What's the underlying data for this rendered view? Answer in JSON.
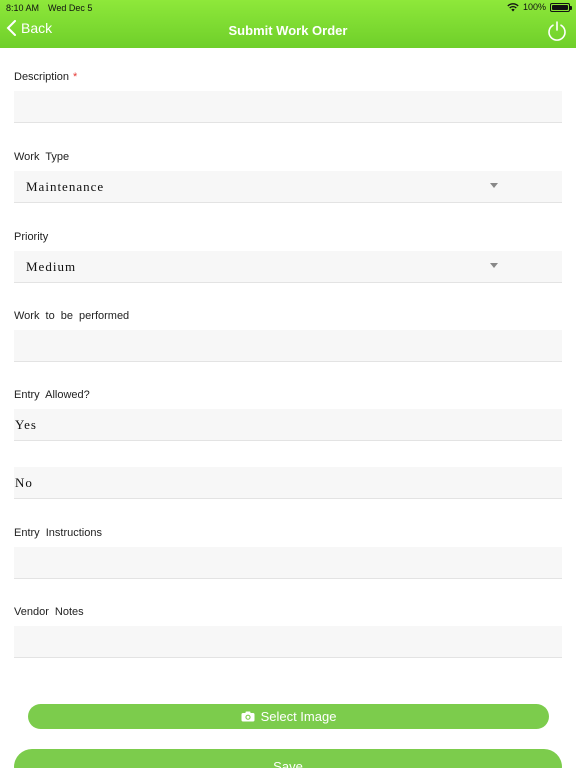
{
  "status_bar": {
    "time": "8:10 AM",
    "date": "Wed Dec 5",
    "battery": "100%",
    "battery_level": 1.0
  },
  "header": {
    "back_label": "Back",
    "title": "Submit Work Order",
    "power_icon": "power-icon"
  },
  "form": {
    "description": {
      "label": "Description",
      "required_mark": "*",
      "value": ""
    },
    "work_type": {
      "label": "Work Type",
      "value": "Maintenance"
    },
    "priority": {
      "label": "Priority",
      "value": "Medium"
    },
    "work_to_be_performed": {
      "label": "Work to be performed",
      "value": ""
    },
    "entry_allowed": {
      "label": "Entry Allowed?",
      "options": [
        "Yes",
        "No"
      ]
    },
    "entry_instructions": {
      "label": "Entry Instructions",
      "value": ""
    },
    "vendor_notes": {
      "label": "Vendor Notes",
      "value": ""
    }
  },
  "actions": {
    "select_image_label": "Select Image",
    "save_label": "Save"
  },
  "colors": {
    "accent": "#7ccc4c",
    "header_top": "#8ee83a",
    "required": "#e53935",
    "field_bg": "#f7f7f7"
  }
}
